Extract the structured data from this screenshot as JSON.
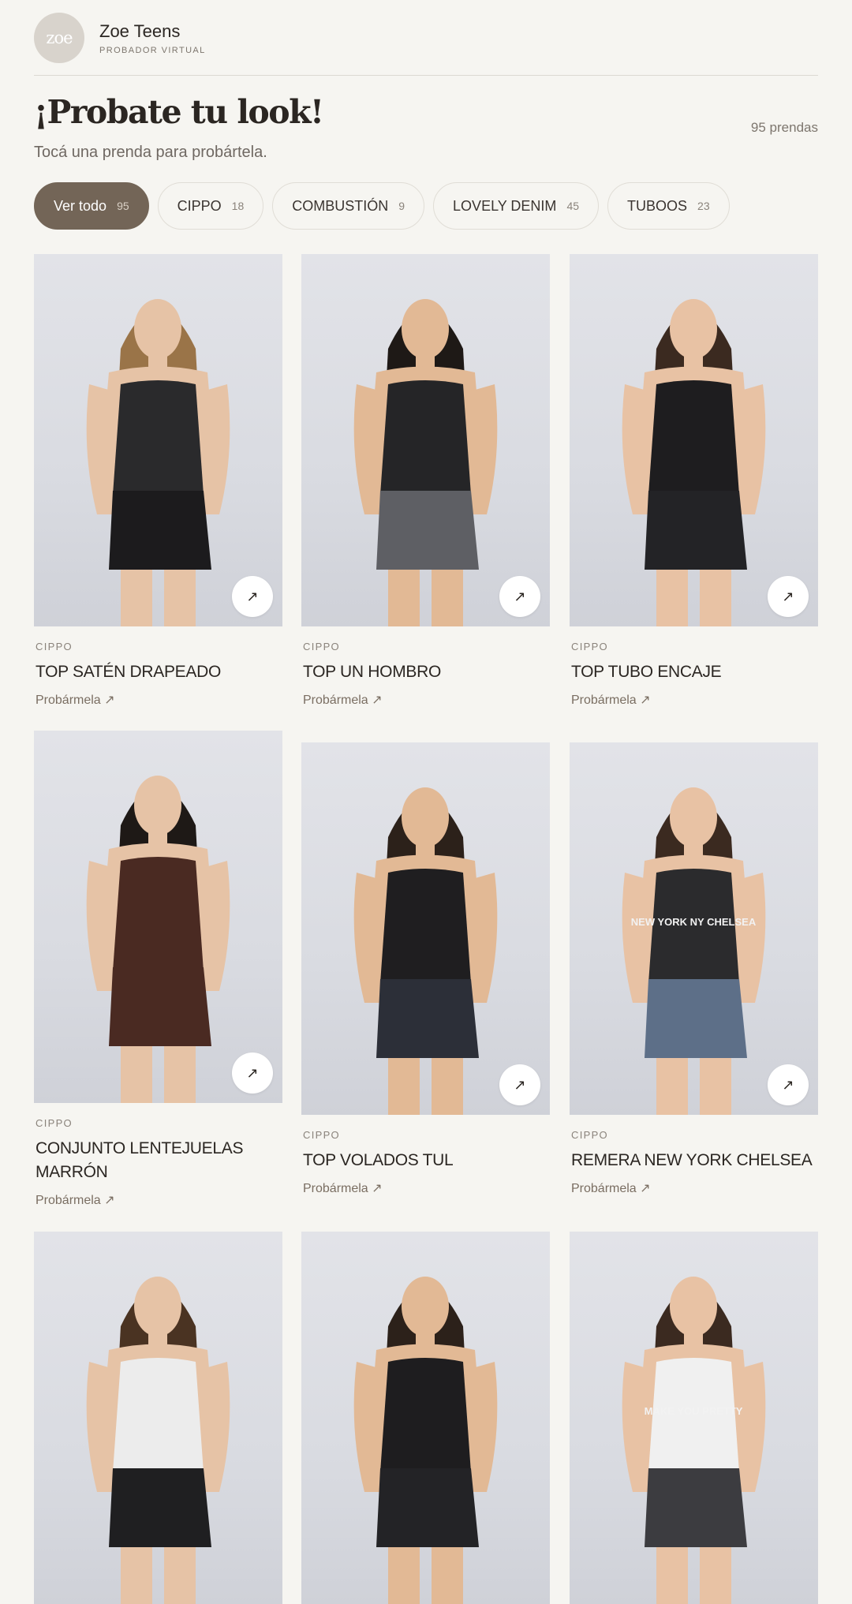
{
  "header": {
    "logo_text": "zoe",
    "brand_name": "Zoe Teens",
    "brand_sub": "PROBADOR VIRTUAL"
  },
  "hero": {
    "title": "¡Probate tu look!",
    "subtitle": "Tocá una prenda para probártela.",
    "count_label": "95 prendas"
  },
  "filters": [
    {
      "label": "Ver todo",
      "count": "95",
      "active": true
    },
    {
      "label": "CIPPO",
      "count": "18",
      "active": false
    },
    {
      "label": "COMBUSTIÓN",
      "count": "9",
      "active": false
    },
    {
      "label": "LOVELY DENIM",
      "count": "45",
      "active": false
    },
    {
      "label": "TUBOOS",
      "count": "23",
      "active": false
    }
  ],
  "products": [
    {
      "brand": "CIPPO",
      "name": "TOP SATÉN DRAPEADO",
      "cta": "Probármela ↗",
      "arrow": "↗",
      "top": "#2a2a2c",
      "bottom": "#1c1b1d",
      "hair": "#9a7448"
    },
    {
      "brand": "CIPPO",
      "name": "TOP UN HOMBRO",
      "cta": "Probármela ↗",
      "arrow": "↗",
      "top": "#252527",
      "bottom": "#5e5f64",
      "hair": "#1e1916"
    },
    {
      "brand": "CIPPO",
      "name": "TOP TUBO ENCAJE",
      "cta": "Probármela ↗",
      "arrow": "↗",
      "top": "#1e1d1f",
      "bottom": "#232326",
      "hair": "#3b2a20"
    },
    {
      "brand": "CIPPO",
      "name": "CONJUNTO LENTEJUELAS MARRÓN",
      "cta": "Probármela ↗",
      "arrow": "↗",
      "top": "#4a2a22",
      "bottom": "#4a2a22",
      "hair": "#1e1916"
    },
    {
      "brand": "CIPPO",
      "name": "TOP VOLADOS TUL",
      "cta": "Probármela ↗",
      "arrow": "↗",
      "top": "#1f1e20",
      "bottom": "#2c2f38",
      "hair": "#2c211a"
    },
    {
      "brand": "CIPPO",
      "name": "REMERA NEW YORK CHELSEA",
      "cta": "Probármela ↗",
      "arrow": "↗",
      "top": "#2b2b2d",
      "bottom": "#5d6f88",
      "hair": "#3b2a20",
      "print": "NEW YORK NY CHELSEA"
    },
    {
      "brand": "",
      "name": "",
      "cta": "",
      "arrow": "",
      "top": "#ececec",
      "bottom": "#1f1f21",
      "hair": "#4a3322"
    },
    {
      "brand": "",
      "name": "",
      "cta": "",
      "arrow": "",
      "top": "#1e1d1f",
      "bottom": "#232326",
      "hair": "#2c211a"
    },
    {
      "brand": "",
      "name": "",
      "cta": "",
      "arrow": "",
      "top": "#f0f0f0",
      "bottom": "#3c3c40",
      "hair": "#3b2a20",
      "print": "MAKE YOU PRETTY"
    }
  ],
  "colors": {
    "background": "#f6f5f1",
    "accent": "#736557",
    "text": "#2b2622",
    "muted": "#8a837b"
  }
}
